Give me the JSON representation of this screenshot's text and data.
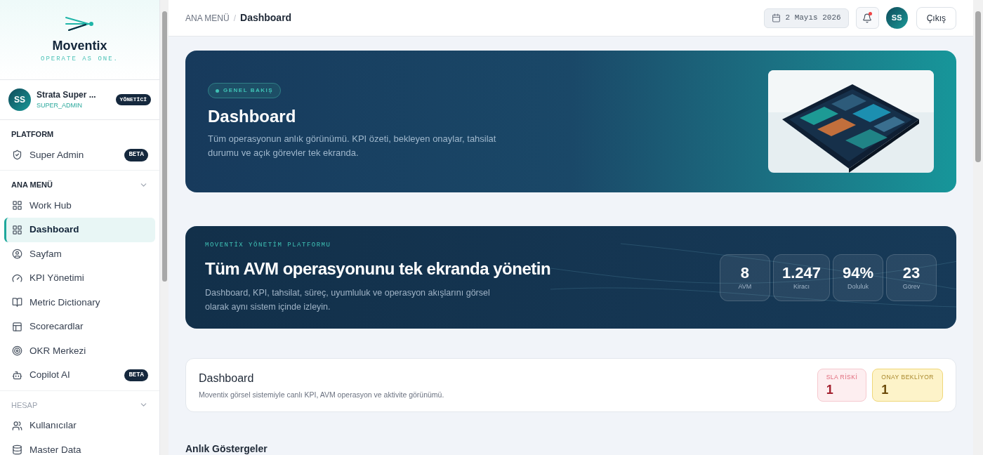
{
  "brand": {
    "name": "Moventix",
    "tagline": "OPERATE AS ONE."
  },
  "user": {
    "initials": "SS",
    "name": "Strata Super ...",
    "role": "SUPER_ADMIN",
    "badge": "YÖNETİCİ"
  },
  "sidebar": {
    "sections": [
      {
        "title": "PLATFORM",
        "items": [
          {
            "label": "Super Admin",
            "badge": "BETA",
            "selected": false
          }
        ]
      },
      {
        "title": "ANA MENÜ",
        "expanded": true,
        "items": [
          {
            "label": "Work Hub",
            "selected": false
          },
          {
            "label": "Dashboard",
            "selected": true
          },
          {
            "label": "Sayfam",
            "selected": false
          },
          {
            "label": "KPI Yönetimi",
            "selected": false
          },
          {
            "label": "Metric Dictionary",
            "selected": false
          },
          {
            "label": "Scorecardlar",
            "selected": false
          },
          {
            "label": "OKR Merkezi",
            "selected": false
          },
          {
            "label": "Copilot AI",
            "badge": "BETA",
            "selected": false
          }
        ]
      },
      {
        "title": "HESAP",
        "expanded": true,
        "items": [
          {
            "label": "Kullanıcılar",
            "selected": false
          },
          {
            "label": "Master Data",
            "selected": false
          }
        ]
      }
    ]
  },
  "header": {
    "breadcrumb": [
      "ANA MENÜ",
      "Dashboard"
    ],
    "breadcrumb_separator": "/",
    "date": "2 Mayıs 2026",
    "notifications_unread": true,
    "avatar": "SS",
    "logout": "Çıkış"
  },
  "hero": {
    "pill": "GENEL BAKIŞ",
    "title": "Dashboard",
    "text": "Tüm operasyonun anlık görünümü. KPI özeti, bekleyen onaylar, tahsilat durumu ve açık görevler tek ekranda."
  },
  "banner": {
    "eyebrow": "MOVENTİX YÖNETİM PLATFORMU",
    "title": "Tüm AVM operasyonunu tek ekranda yönetin",
    "text": "Dashboard, KPI, tahsilat, süreç, uyumluluk ve operasyon akışlarını görsel olarak aynı sistem içinde izleyin.",
    "stats": [
      {
        "value": "8",
        "label": "AVM"
      },
      {
        "value": "1.247",
        "label": "Kiracı"
      },
      {
        "value": "94%",
        "label": "Doluluk"
      },
      {
        "value": "23",
        "label": "Görev"
      }
    ]
  },
  "summary": {
    "title": "Dashboard",
    "subtitle": "Moventix görsel sistemiyle canlı KPI, AVM operasyon ve aktivite görünümü.",
    "chips": [
      {
        "kind": "danger",
        "label": "SLA RİSKİ",
        "value": "1"
      },
      {
        "kind": "warning",
        "label": "ONAY BEKLİYOR",
        "value": "1"
      }
    ]
  },
  "section_title": "Anlık Göstergeler"
}
